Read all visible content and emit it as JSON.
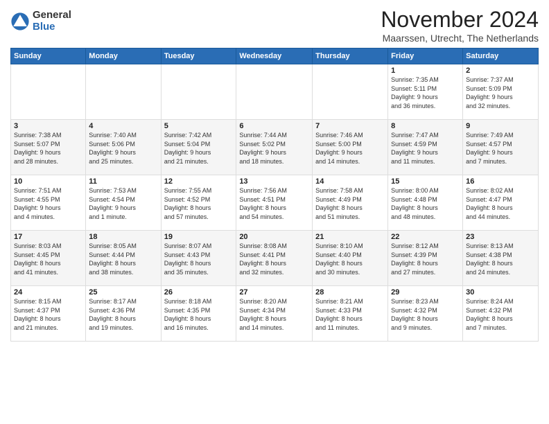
{
  "logo": {
    "general": "General",
    "blue": "Blue"
  },
  "title": "November 2024",
  "location": "Maarssen, Utrecht, The Netherlands",
  "headers": [
    "Sunday",
    "Monday",
    "Tuesday",
    "Wednesday",
    "Thursday",
    "Friday",
    "Saturday"
  ],
  "weeks": [
    [
      {
        "day": "",
        "info": ""
      },
      {
        "day": "",
        "info": ""
      },
      {
        "day": "",
        "info": ""
      },
      {
        "day": "",
        "info": ""
      },
      {
        "day": "",
        "info": ""
      },
      {
        "day": "1",
        "info": "Sunrise: 7:35 AM\nSunset: 5:11 PM\nDaylight: 9 hours\nand 36 minutes."
      },
      {
        "day": "2",
        "info": "Sunrise: 7:37 AM\nSunset: 5:09 PM\nDaylight: 9 hours\nand 32 minutes."
      }
    ],
    [
      {
        "day": "3",
        "info": "Sunrise: 7:38 AM\nSunset: 5:07 PM\nDaylight: 9 hours\nand 28 minutes."
      },
      {
        "day": "4",
        "info": "Sunrise: 7:40 AM\nSunset: 5:06 PM\nDaylight: 9 hours\nand 25 minutes."
      },
      {
        "day": "5",
        "info": "Sunrise: 7:42 AM\nSunset: 5:04 PM\nDaylight: 9 hours\nand 21 minutes."
      },
      {
        "day": "6",
        "info": "Sunrise: 7:44 AM\nSunset: 5:02 PM\nDaylight: 9 hours\nand 18 minutes."
      },
      {
        "day": "7",
        "info": "Sunrise: 7:46 AM\nSunset: 5:00 PM\nDaylight: 9 hours\nand 14 minutes."
      },
      {
        "day": "8",
        "info": "Sunrise: 7:47 AM\nSunset: 4:59 PM\nDaylight: 9 hours\nand 11 minutes."
      },
      {
        "day": "9",
        "info": "Sunrise: 7:49 AM\nSunset: 4:57 PM\nDaylight: 9 hours\nand 7 minutes."
      }
    ],
    [
      {
        "day": "10",
        "info": "Sunrise: 7:51 AM\nSunset: 4:55 PM\nDaylight: 9 hours\nand 4 minutes."
      },
      {
        "day": "11",
        "info": "Sunrise: 7:53 AM\nSunset: 4:54 PM\nDaylight: 9 hours\nand 1 minute."
      },
      {
        "day": "12",
        "info": "Sunrise: 7:55 AM\nSunset: 4:52 PM\nDaylight: 8 hours\nand 57 minutes."
      },
      {
        "day": "13",
        "info": "Sunrise: 7:56 AM\nSunset: 4:51 PM\nDaylight: 8 hours\nand 54 minutes."
      },
      {
        "day": "14",
        "info": "Sunrise: 7:58 AM\nSunset: 4:49 PM\nDaylight: 8 hours\nand 51 minutes."
      },
      {
        "day": "15",
        "info": "Sunrise: 8:00 AM\nSunset: 4:48 PM\nDaylight: 8 hours\nand 48 minutes."
      },
      {
        "day": "16",
        "info": "Sunrise: 8:02 AM\nSunset: 4:47 PM\nDaylight: 8 hours\nand 44 minutes."
      }
    ],
    [
      {
        "day": "17",
        "info": "Sunrise: 8:03 AM\nSunset: 4:45 PM\nDaylight: 8 hours\nand 41 minutes."
      },
      {
        "day": "18",
        "info": "Sunrise: 8:05 AM\nSunset: 4:44 PM\nDaylight: 8 hours\nand 38 minutes."
      },
      {
        "day": "19",
        "info": "Sunrise: 8:07 AM\nSunset: 4:43 PM\nDaylight: 8 hours\nand 35 minutes."
      },
      {
        "day": "20",
        "info": "Sunrise: 8:08 AM\nSunset: 4:41 PM\nDaylight: 8 hours\nand 32 minutes."
      },
      {
        "day": "21",
        "info": "Sunrise: 8:10 AM\nSunset: 4:40 PM\nDaylight: 8 hours\nand 30 minutes."
      },
      {
        "day": "22",
        "info": "Sunrise: 8:12 AM\nSunset: 4:39 PM\nDaylight: 8 hours\nand 27 minutes."
      },
      {
        "day": "23",
        "info": "Sunrise: 8:13 AM\nSunset: 4:38 PM\nDaylight: 8 hours\nand 24 minutes."
      }
    ],
    [
      {
        "day": "24",
        "info": "Sunrise: 8:15 AM\nSunset: 4:37 PM\nDaylight: 8 hours\nand 21 minutes."
      },
      {
        "day": "25",
        "info": "Sunrise: 8:17 AM\nSunset: 4:36 PM\nDaylight: 8 hours\nand 19 minutes."
      },
      {
        "day": "26",
        "info": "Sunrise: 8:18 AM\nSunset: 4:35 PM\nDaylight: 8 hours\nand 16 minutes."
      },
      {
        "day": "27",
        "info": "Sunrise: 8:20 AM\nSunset: 4:34 PM\nDaylight: 8 hours\nand 14 minutes."
      },
      {
        "day": "28",
        "info": "Sunrise: 8:21 AM\nSunset: 4:33 PM\nDaylight: 8 hours\nand 11 minutes."
      },
      {
        "day": "29",
        "info": "Sunrise: 8:23 AM\nSunset: 4:32 PM\nDaylight: 8 hours\nand 9 minutes."
      },
      {
        "day": "30",
        "info": "Sunrise: 8:24 AM\nSunset: 4:32 PM\nDaylight: 8 hours\nand 7 minutes."
      }
    ]
  ]
}
